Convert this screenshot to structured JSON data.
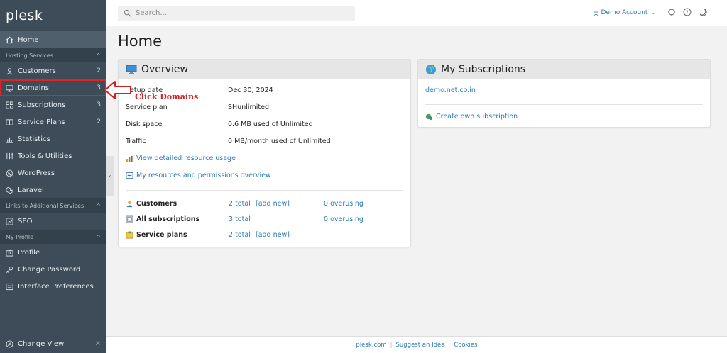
{
  "app": {
    "logo": "plesk"
  },
  "sidebar": {
    "items": [
      {
        "key": "home",
        "label": "Home",
        "icon": "home-icon",
        "count": ""
      },
      {
        "key": "section-hosting",
        "label": "Hosting Services",
        "section": true
      },
      {
        "key": "customers",
        "label": "Customers",
        "icon": "user-icon",
        "count": "2"
      },
      {
        "key": "domains",
        "label": "Domains",
        "icon": "monitor-icon",
        "count": "3"
      },
      {
        "key": "subscriptions",
        "label": "Subscriptions",
        "icon": "grid-icon",
        "count": "3"
      },
      {
        "key": "service-plans",
        "label": "Service Plans",
        "icon": "book-icon",
        "count": "2"
      },
      {
        "key": "statistics",
        "label": "Statistics",
        "icon": "bar-chart-icon",
        "count": ""
      },
      {
        "key": "tools",
        "label": "Tools & Utilities",
        "icon": "tools-icon",
        "count": ""
      },
      {
        "key": "wordpress",
        "label": "WordPress",
        "icon": "wordpress-icon",
        "count": ""
      },
      {
        "key": "laravel",
        "label": "Laravel",
        "icon": "laravel-icon",
        "count": ""
      },
      {
        "key": "section-links",
        "label": "Links to Additional Services",
        "section": true
      },
      {
        "key": "seo",
        "label": "SEO",
        "icon": "trend-icon",
        "count": ""
      },
      {
        "key": "section-profile",
        "label": "My Profile",
        "section": true
      },
      {
        "key": "profile",
        "label": "Profile",
        "icon": "profile-icon",
        "count": ""
      },
      {
        "key": "change-password",
        "label": "Change Password",
        "icon": "key-icon",
        "count": ""
      },
      {
        "key": "interface-prefs",
        "label": "Interface Preferences",
        "icon": "prefs-icon",
        "count": ""
      }
    ],
    "change_view": "Change View"
  },
  "topbar": {
    "search_placeholder": "Search...",
    "account": "Demo Account"
  },
  "main": {
    "title": "Home",
    "overview": {
      "title": "Overview",
      "rows": [
        {
          "label": "Setup date",
          "value": "Dec 30, 2024"
        },
        {
          "label": "Service plan",
          "value": "SHunlimited"
        },
        {
          "label": "Disk space",
          "value": "0.6 MB used of Unlimited"
        },
        {
          "label": "Traffic",
          "value": "0 MB/month used of Unlimited"
        }
      ],
      "links": [
        "View detailed resource usage",
        "My resources and permissions overview"
      ],
      "stats": [
        {
          "label": "Customers",
          "total": "2 total",
          "add": "[add new]",
          "over": "0 overusing"
        },
        {
          "label": "All subscriptions",
          "total": "3 total",
          "add": "",
          "over": "0 overusing"
        },
        {
          "label": "Service plans",
          "total": "2 total",
          "add": "[add new]",
          "over": ""
        }
      ]
    },
    "subscriptions": {
      "title": "My Subscriptions",
      "domain": "demo.net.co.in",
      "create": "Create own subscription"
    }
  },
  "footer": {
    "links": [
      "plesk.com",
      "Suggest an Idea",
      "Cookies"
    ]
  },
  "annotation": {
    "text": "Click Domains",
    "color": "#d02020"
  },
  "colors": {
    "sidebar_bg": "#3d4c58",
    "link": "#2a7ab7",
    "highlight": "#e52222"
  }
}
